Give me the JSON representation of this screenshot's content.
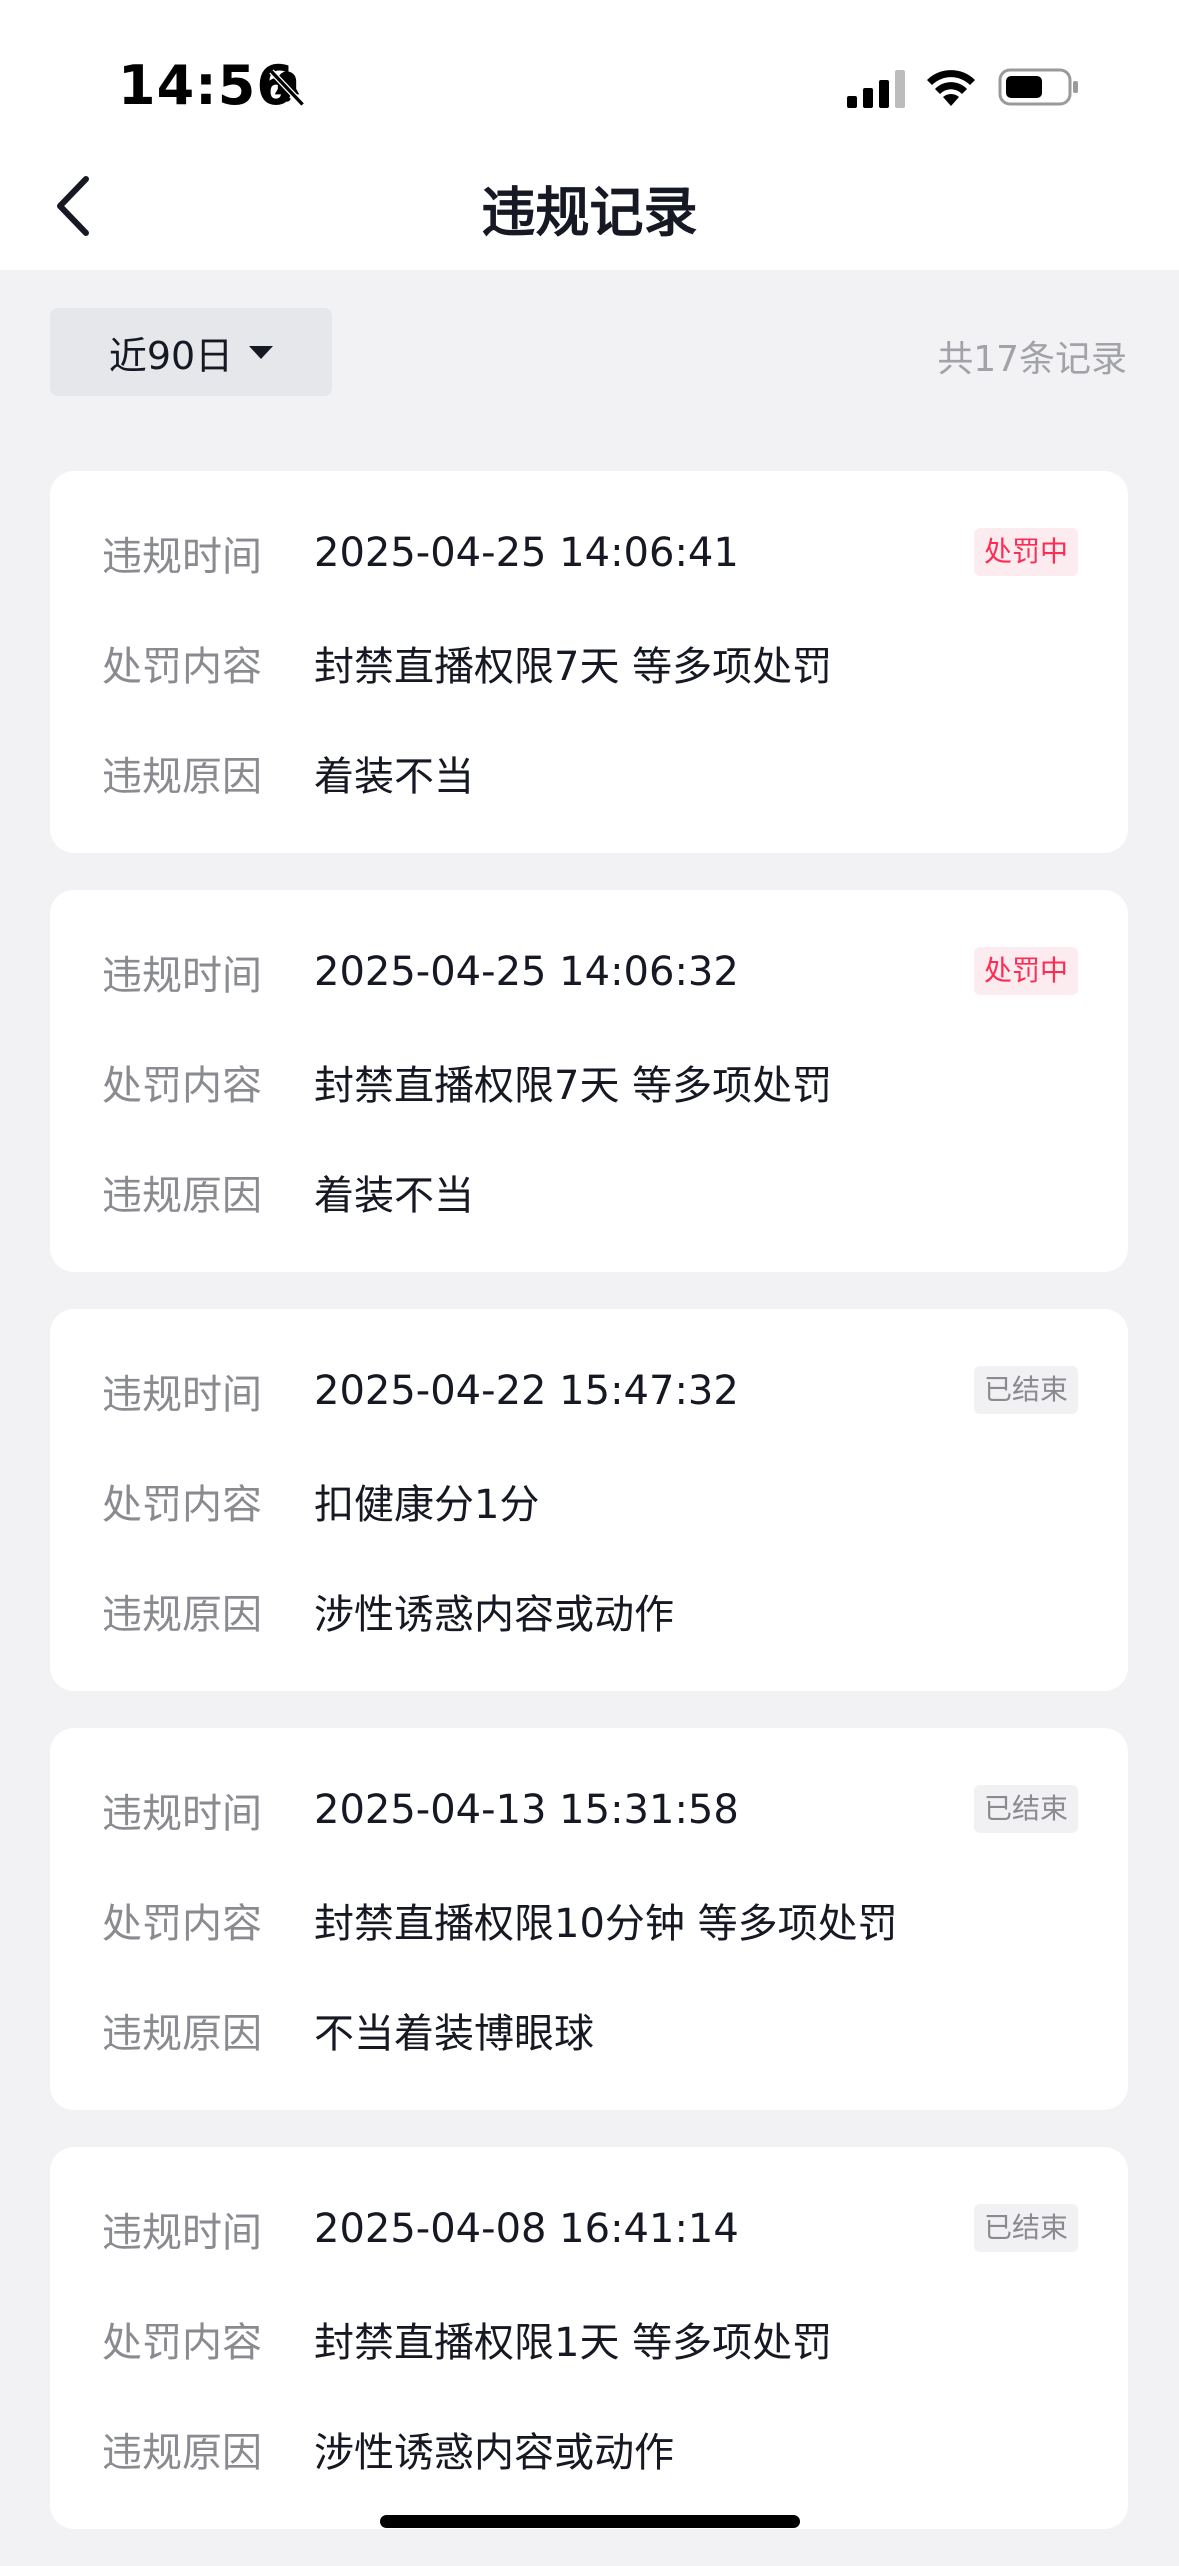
{
  "status_bar": {
    "time": "14:56"
  },
  "nav": {
    "title": "违规记录"
  },
  "filter": {
    "label": "近90日"
  },
  "summary": {
    "count_text": "共17条记录"
  },
  "labels": {
    "time": "违规时间",
    "content": "处罚内容",
    "reason": "违规原因"
  },
  "records": [
    {
      "time": "2025-04-25 14:06:41",
      "content": "封禁直播权限7天 等多项处罚",
      "reason": "着装不当",
      "status": "处罚中",
      "status_type": "active"
    },
    {
      "time": "2025-04-25 14:06:32",
      "content": "封禁直播权限7天 等多项处罚",
      "reason": "着装不当",
      "status": "处罚中",
      "status_type": "active"
    },
    {
      "time": "2025-04-22 15:47:32",
      "content": "扣健康分1分",
      "reason": "涉性诱惑内容或动作",
      "status": "已结束",
      "status_type": "ended"
    },
    {
      "time": "2025-04-13 15:31:58",
      "content": "封禁直播权限10分钟 等多项处罚",
      "reason": "不当着装博眼球",
      "status": "已结束",
      "status_type": "ended"
    },
    {
      "time": "2025-04-08 16:41:14",
      "content": "封禁直播权限1天 等多项处罚",
      "reason": "涉性诱惑内容或动作",
      "status": "已结束",
      "status_type": "ended"
    }
  ],
  "colors": {
    "accent_red": "#fe2c55",
    "background": "#f2f2f4"
  },
  "icons": [
    "bell-off-icon",
    "signal-icon",
    "wifi-icon",
    "battery-icon",
    "back-arrow-icon",
    "caret-down-icon"
  ]
}
